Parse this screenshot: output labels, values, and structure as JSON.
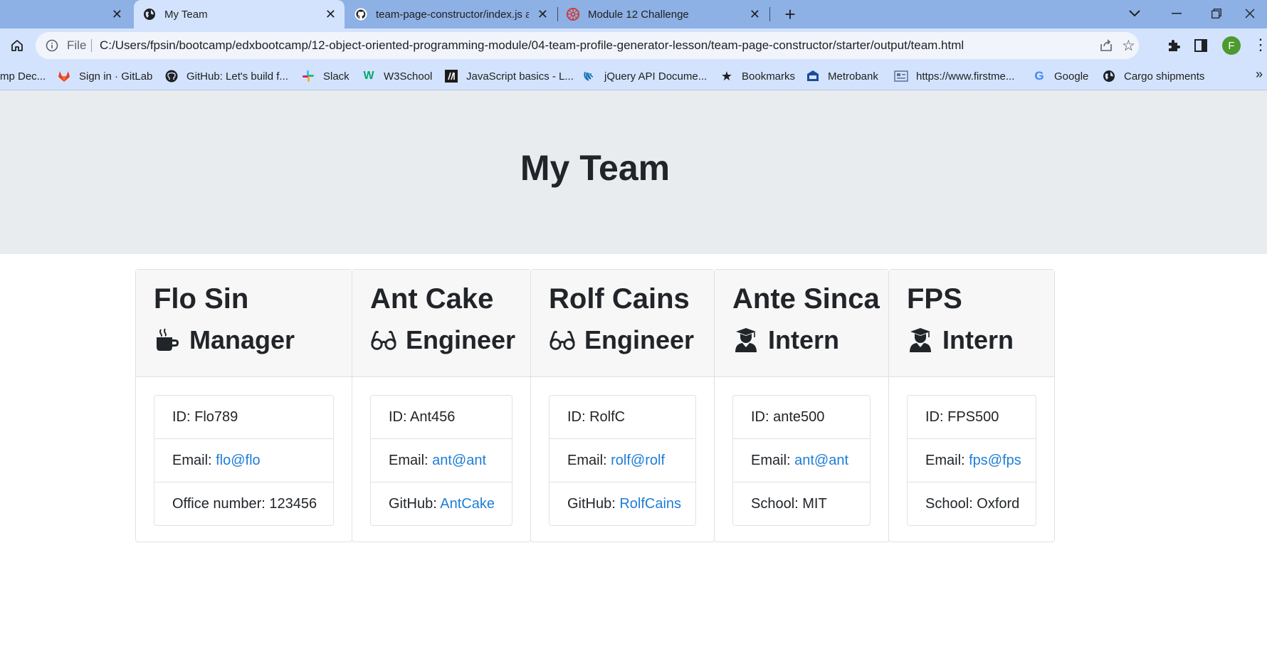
{
  "browser": {
    "tabs": [
      {
        "label": "",
        "active": false
      },
      {
        "label": "My Team",
        "active": true
      },
      {
        "label": "team-page-constructor/index.js at",
        "active": false
      },
      {
        "label": "Module 12 Challenge",
        "active": false
      }
    ],
    "address": {
      "scheme_label": "File",
      "url": "C:/Users/fpsin/bootcamp/edxbootcamp/12-object-oriented-programming-module/04-team-profile-generator-lesson/team-page-constructor/starter/output/team.html"
    },
    "profile_initial": "F",
    "bookmarks": [
      {
        "label": "mp Dec...",
        "icon": "bookmark-partial-icon"
      },
      {
        "label": "Sign in · GitLab",
        "icon": "gitlab-icon"
      },
      {
        "label": "GitHub: Let's build f...",
        "icon": "github-icon"
      },
      {
        "label": "Slack",
        "icon": "slack-icon"
      },
      {
        "label": "W3School",
        "icon": "w3school-icon"
      },
      {
        "label": "JavaScript basics - L...",
        "icon": "mdn-icon"
      },
      {
        "label": "jQuery API Docume...",
        "icon": "jquery-icon"
      },
      {
        "label": "Bookmarks",
        "icon": "star-icon"
      },
      {
        "label": "Metrobank",
        "icon": "bank-icon"
      },
      {
        "label": "https://www.firstme...",
        "icon": "page-icon"
      },
      {
        "label": "Google",
        "icon": "google-icon"
      },
      {
        "label": "Cargo shipments",
        "icon": "globe-icon"
      }
    ],
    "colors": {
      "tabstrip": "#8db0e5",
      "toolbar": "#d3e3fd",
      "avatar": "#4d9a2e"
    }
  },
  "page": {
    "title": "My Team",
    "cards": [
      {
        "name": "Flo Sin",
        "role": "Manager",
        "role_icon": "mug-icon",
        "id_text": "ID: Flo789",
        "email_label": "Email: ",
        "email": "flo@flo",
        "extra_label": "Office number: 123456",
        "extra_link": ""
      },
      {
        "name": "Ant Cake",
        "role": "Engineer",
        "role_icon": "glasses-icon",
        "id_text": "ID: Ant456",
        "email_label": "Email: ",
        "email": "ant@ant",
        "extra_label": "GitHub: ",
        "extra_link": "AntCake"
      },
      {
        "name": "Rolf Cains",
        "role": "Engineer",
        "role_icon": "glasses-icon",
        "id_text": "ID: RolfC",
        "email_label": "Email: ",
        "email": "rolf@rolf",
        "extra_label": "GitHub: ",
        "extra_link": "RolfCains"
      },
      {
        "name": "Ante Sinca",
        "role": "Intern",
        "role_icon": "graduate-icon",
        "id_text": "ID: ante500",
        "email_label": "Email: ",
        "email": "ant@ant",
        "extra_label": "School: MIT",
        "extra_link": ""
      },
      {
        "name": "FPS",
        "role": "Intern",
        "role_icon": "graduate-icon",
        "id_text": "ID: FPS500",
        "email_label": "Email: ",
        "email": "fps@fps",
        "extra_label": "School: Oxford",
        "extra_link": ""
      }
    ],
    "colors": {
      "jumbotron": "#e9ecef",
      "link": "#1e7dd7",
      "text": "#212529"
    }
  }
}
